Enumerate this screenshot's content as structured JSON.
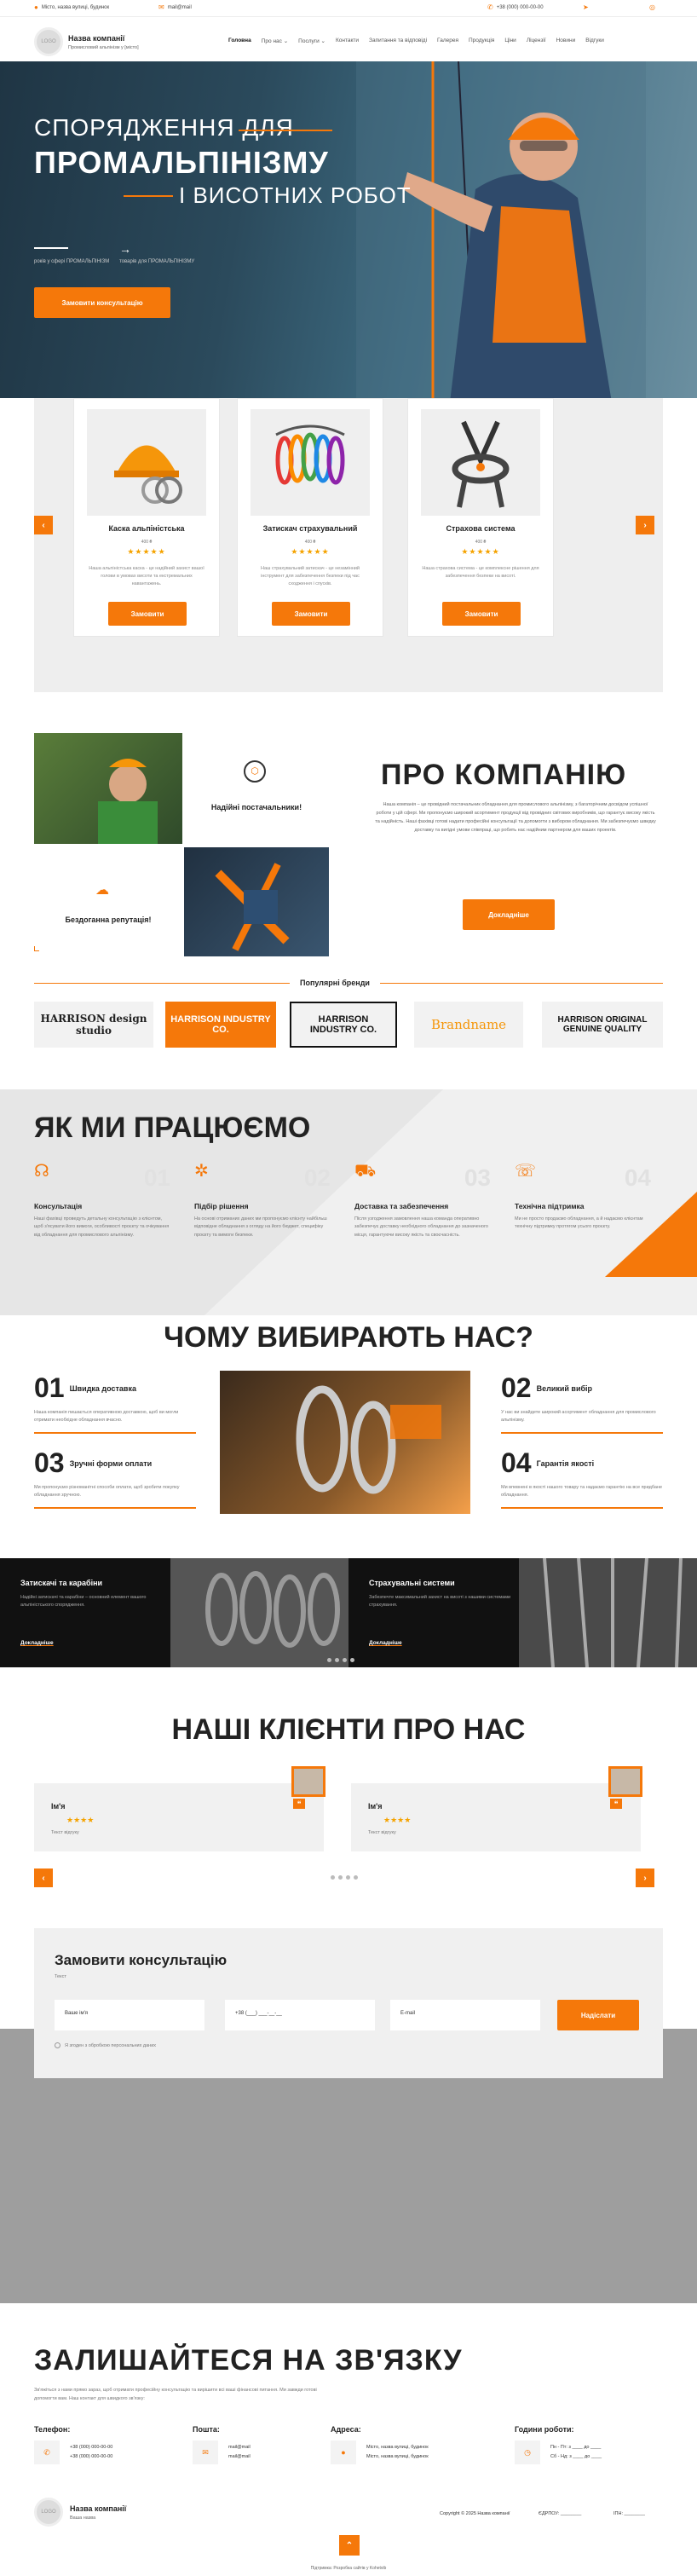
{
  "topbar": {
    "address": "Місто, назва вулиці, будинок",
    "email": "mail@mail",
    "phone": "+38 (000) 000-00-00"
  },
  "header": {
    "logo_text": "LOGO",
    "company": "Назва компанії",
    "tagline": "Промисловий альпінізм у [місто]"
  },
  "nav": [
    "Головна",
    "Про нас ⌄",
    "Послуги ⌄",
    "Контакти",
    "Запитання та відповіді",
    "Галерея",
    "Продукція",
    "Ціни",
    "Ліцензії",
    "Новини",
    "Відгуки"
  ],
  "hero": {
    "line1": "СПОРЯДЖЕННЯ ДЛЯ",
    "line2": "ПРОМАЛЬПІНІЗМУ",
    "line3": "І ВИСОТНИХ РОБОТ",
    "stat1": "років у сфері ПРОМАЛЬПІНІЗМ",
    "stat2": "товарів для ПРОМАЛЬПІНІЗМУ",
    "cta": "Замовити консультацію"
  },
  "products": [
    {
      "name": "Каска альпіністська",
      "price": "400 ₴",
      "stars": "★★★★★",
      "desc": "Наша альпіністська каска - це надійний захист вашої голови в умовах висоти та екстремальних навантажень.",
      "button": "Замовити"
    },
    {
      "name": "Затискач страхувальний",
      "price": "400 ₴",
      "stars": "★★★★★",
      "desc": "Наш страхувальний затискач - це незамінний інструмент для забезпечення безпеки під час сходження і спусків.",
      "button": "Замовити"
    },
    {
      "name": "Страхова система",
      "price": "400 ₴",
      "stars": "★★★★★",
      "desc": "Наша страхова система - це комплексне рішення для забезпечення безпеки на висоті.",
      "button": "Замовити"
    }
  ],
  "about": {
    "title": "ПРО КОМПАНІЮ",
    "text": "Наша компанія – це провідний постачальник обладнання для промислового альпінізму, з багаторічним досвідом успішної роботи у цій сфері. Ми пропонуємо широкий асортимент продукції від провідних світових виробників, що гарантує високу якість та надійність. Наші фахівці готові надати професійні консультації та допомогти з вибором обладнання. Ми забезпечуємо швидку доставку та вигідні умови співпраці, що робить нас надійним партнером для ваших проектів.",
    "tile1": "Надійні постачальники!",
    "tile2": "Бездоганна репутація!",
    "button": "Докладніше"
  },
  "brands": {
    "title": "Популярні бренди",
    "items": [
      "HARRISON design studio",
      "HARRISON INDUSTRY CO.",
      "HARRISON INDUSTRY CO.",
      "Brandname",
      "HARRISON ORIGINAL GENUINE QUALITY"
    ]
  },
  "how": {
    "title": "ЯК МИ ПРАЦЮЄМО",
    "steps": [
      {
        "num": "01",
        "title": "Консультація",
        "desc": "Наші фахівці проведуть детальну консультацію з клієнтом, щоб з'ясувати його вимоги, особливості проєкту та очікування від обладнання для промислового альпінізму."
      },
      {
        "num": "02",
        "title": "Підбір рішення",
        "desc": "На основі отриманих даних ми пропонуємо клієнту найбільш відповідне обладнання з огляду на його бюджет, специфіку проєкту та вимоги безпеки."
      },
      {
        "num": "03",
        "title": "Доставка та забезпечення",
        "desc": "Після узгодження замовлення наша команда оперативно забезпечує доставку необхідного обладнання до зазначеного місця, гарантуючи високу якість та своєчасність."
      },
      {
        "num": "04",
        "title": "Технічна підтримка",
        "desc": "Ми не просто продаємо обладнання, а й надаємо клієнтам технічну підтримку протягом усього проєкту."
      }
    ]
  },
  "why": {
    "title": "ЧОМУ ВИБИРАЮТЬ НАС?",
    "items": [
      {
        "num": "01",
        "label": "Швидка доставка",
        "desc": "Наша компанія пишається оперативною доставкою, щоб ви могли отримати необхідне обладнання вчасно."
      },
      {
        "num": "02",
        "label": "Великий вибір",
        "desc": "У нас ви знайдете широкий асортимент обладнання для промислового альпінізму."
      },
      {
        "num": "03",
        "label": "Зручні форми оплати",
        "desc": "Ми пропонуємо різноманітні способи оплати, щоб зробити покупку обладнання зручною."
      },
      {
        "num": "04",
        "label": "Гарантія якості",
        "desc": "Ми впевнені в якості нашого товару та надаємо гарантію на все придбане обладнання."
      }
    ]
  },
  "services": [
    {
      "title": "Затискачі та карабіни",
      "desc": "Надійні затискачі та карабіни – основний елемент вашого альпіністського спорядження.",
      "link": "Докладніше"
    },
    {
      "title": "Страхувальні системи",
      "desc": "Забезпечте максимальний захист на висоті з нашими системами страхування.",
      "link": "Докладніше"
    }
  ],
  "reviews": {
    "title": "НАШІ КЛІЄНТИ ПРО НАС",
    "items": [
      {
        "name": "Ім'я",
        "stars": "★★★★",
        "text": "Текст відгуку"
      },
      {
        "name": "Ім'я",
        "stars": "★★★★",
        "text": "Текст відгуку"
      }
    ]
  },
  "form": {
    "title": "Замовити консультацію",
    "subtitle": "Текст",
    "name_placeholder": "Ваше ім'я",
    "phone_placeholder": "+38 (___) ___-__-__",
    "email_placeholder": "E-mail",
    "submit": "Надіслати",
    "consent": "Я згоден з обробкою персональних даних"
  },
  "contacts": {
    "title": "ЗАЛИШАЙТЕСЯ НА ЗВ'ЯЗКУ",
    "text": "Зв'яжіться з нами прямо зараз, щоб отримати професійну консультацію та вирішити всі ваші фінансові питання. Ми завжди готові допомогти вам. Наш контакт для швидкого зв'язку:",
    "phone_label": "Телефон:",
    "phones": [
      "+38 (000) 000-00-00",
      "+38 (000) 000-00-00"
    ],
    "mail_label": "Пошта:",
    "mails": [
      "mail@mail",
      "mail@mail"
    ],
    "address_label": "Адреса:",
    "addresses": [
      "Місто, назва вулиці, будинок",
      "Місто, назва вулиці, будинок"
    ],
    "hours_label": "Години роботи:",
    "hours": [
      "Пн - Пт: з ____ до ____",
      "Сб - Нд: з ____ до ____"
    ]
  },
  "footer": {
    "logo_text": "LOGO",
    "company": "Назва компанії",
    "tagline": "Ваша назва",
    "copyright": "Copyright © 2025 Назва компанії",
    "edrpou": "ЄДРПОУ: ________",
    "ipn": "ІПН: ________",
    "credit": "Підтримка: Розробка сайтів у Kohetvib"
  },
  "colors": {
    "accent": "#f5780a",
    "dark": "#111111",
    "light": "#f0f0f0"
  }
}
